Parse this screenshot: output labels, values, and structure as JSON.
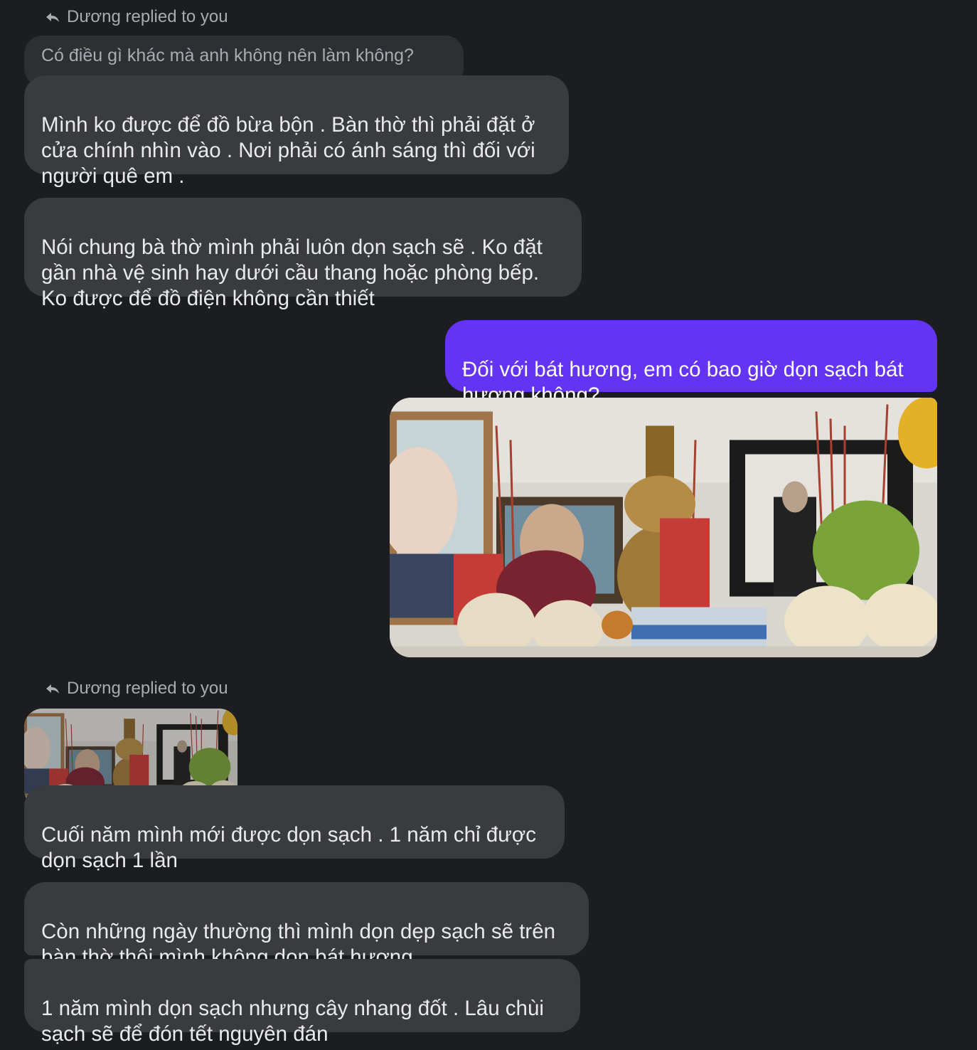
{
  "thread": {
    "reply1": {
      "label": "Dương replied to you",
      "quoted_text": "Có điều gì khác mà anh không nên làm không?"
    },
    "msg1": "Mình ko được để đồ bừa bộn . Bàn thờ thì phải đặt ở\ncửa chính nhìn vào . Nơi phải có ánh sáng thì đối với\nngười quê em .",
    "msg2": "Nói chung bà thờ mình phải luôn dọn sạch sẽ . Ko đặt\ngần nhà vệ sinh hay dưới cầu thang hoặc phòng bếp.\nKo được để đồ điện không cần thiết",
    "my_msg": "Đối với bát hương, em có bao giờ dọn sạch bát\nhương không?",
    "reply2": {
      "label": "Dương replied to you"
    },
    "msg3": "Cuối năm mình mới được dọn sạch . 1 năm chỉ được\ndọn sạch 1 lần",
    "msg4": "Còn những ngày thường thì mình dọn dẹp sạch sẽ trên\nbàn thờ thôi mình không dọn bát hương",
    "msg5": "1 năm mình dọn sạch nhưng cây nhang đốt . Lâu chùi\nsạch sẽ để đón tết nguyên đán"
  },
  "icons": {
    "reply": "reply-arrow-icon"
  },
  "colors": {
    "background": "#1c1d20",
    "incoming_bubble": "#3a3b3f",
    "outgoing_bubble": "#6434f5",
    "muted_text": "#a8abb1"
  }
}
